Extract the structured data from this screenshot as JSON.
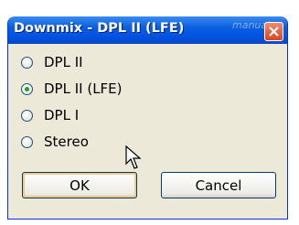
{
  "window": {
    "title": "Downmix - DPL II (LFE)",
    "watermark": "manual"
  },
  "options": [
    {
      "label": "DPL II",
      "selected": false
    },
    {
      "label": "DPL II (LFE)",
      "selected": true
    },
    {
      "label": "DPL I",
      "selected": false
    },
    {
      "label": "Stereo",
      "selected": false
    }
  ],
  "buttons": {
    "ok": "OK",
    "cancel": "Cancel"
  }
}
